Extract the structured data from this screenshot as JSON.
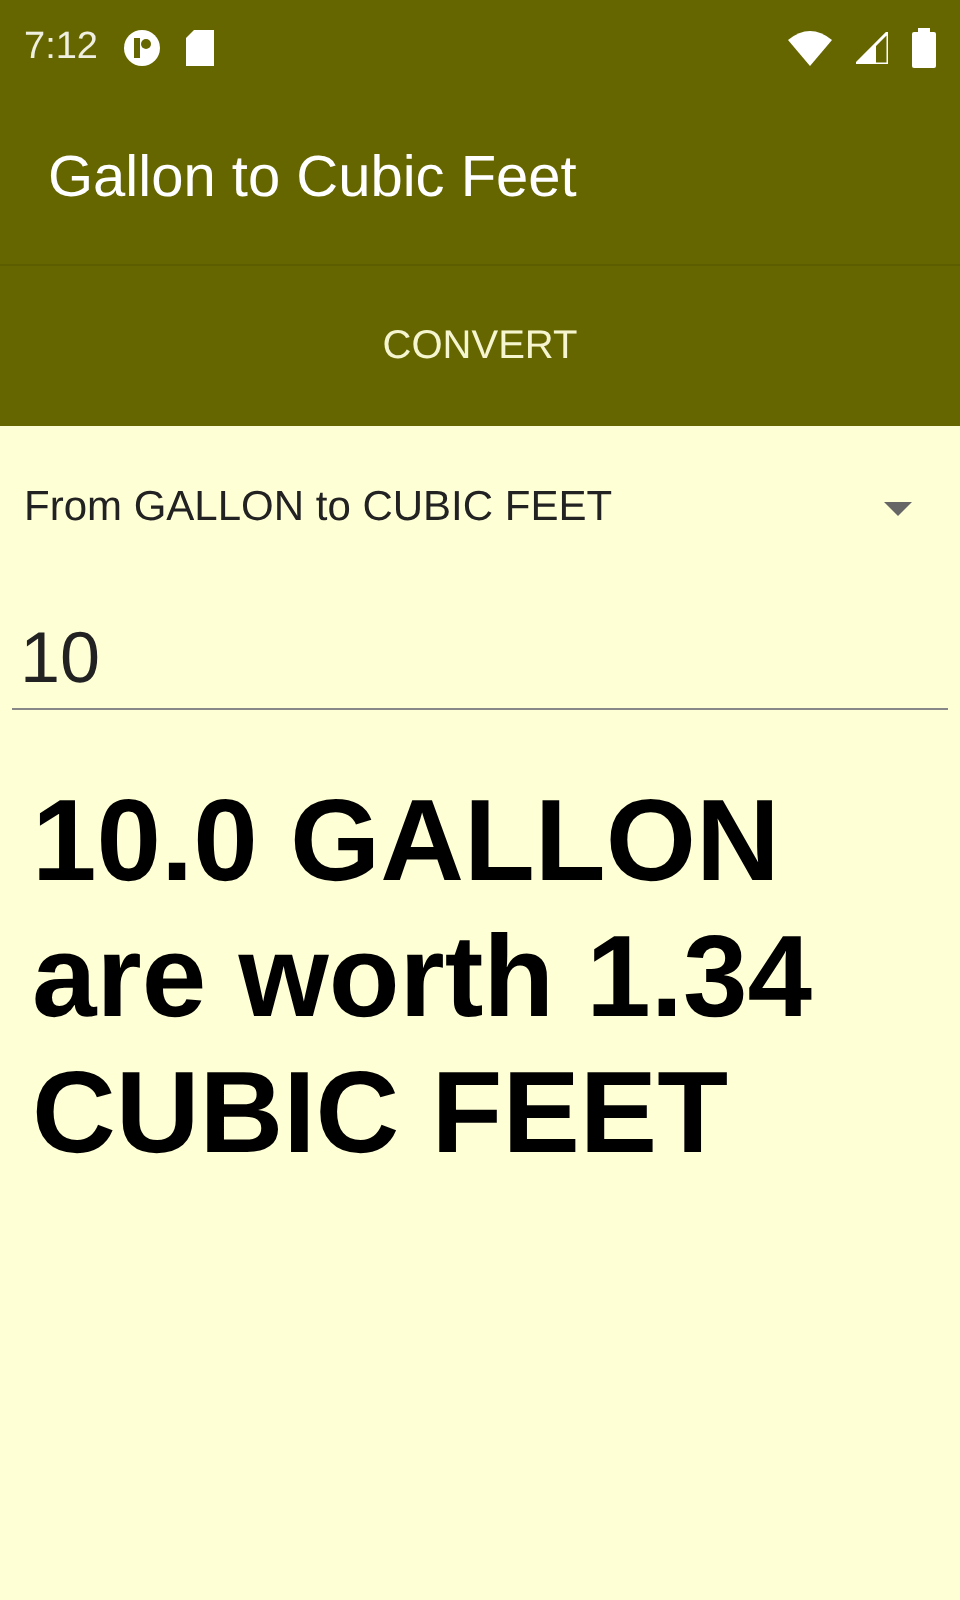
{
  "status_bar": {
    "time": "7:12"
  },
  "app_bar": {
    "title": "Gallon to Cubic Feet"
  },
  "convert_button": {
    "label": "CONVERT"
  },
  "unit_dropdown": {
    "value": "From GALLON to CUBIC FEET"
  },
  "amount_field": {
    "value": "10"
  },
  "result": {
    "text": "10.0 GALLON are worth 1.34 CUBIC FEET"
  }
}
